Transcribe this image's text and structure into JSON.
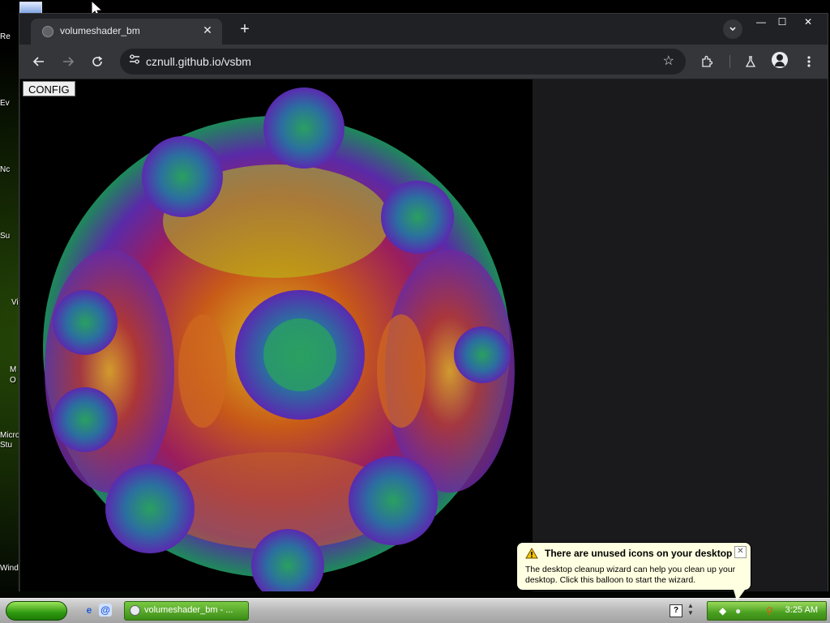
{
  "desktop": {
    "icon_labels": [
      "Re",
      "Ev",
      "Nc",
      "Su",
      "Vi",
      "M\nO",
      "Micro\nStu",
      "Wind"
    ]
  },
  "browser": {
    "tab_title": "volumeshader_bm",
    "tab_close": "✕",
    "new_tab": "+",
    "url": "cznull.github.io/vsbm",
    "window_controls": {
      "minimize": "—",
      "maximize": "☐",
      "close": "✕"
    }
  },
  "page": {
    "config_button": "CONFIG"
  },
  "taskbar": {
    "task_label": "volumeshader_bm - ...",
    "help_icon": "?",
    "clock": "3:25 AM"
  },
  "balloon": {
    "title": "There are unused icons on your desktop",
    "body": "The desktop cleanup wizard can help you clean up your desktop. Click this balloon to start the wizard.",
    "close": "✕"
  },
  "colors": {
    "browser_bg": "#202124",
    "toolbar_bg": "#35363a",
    "viewport_bg": "#000000",
    "balloon_bg": "#ffffe1",
    "taskbar_green": "#3b8c16"
  },
  "icons": [
    "globe-icon",
    "close-icon",
    "plus-icon",
    "chevron-down-icon",
    "back-arrow-icon",
    "forward-arrow-icon",
    "reload-icon",
    "tune-icon",
    "star-icon",
    "extensions-icon",
    "labs-icon",
    "profile-icon",
    "menu-icon",
    "warning-icon",
    "help-icon",
    "ie-icon",
    "clock"
  ]
}
